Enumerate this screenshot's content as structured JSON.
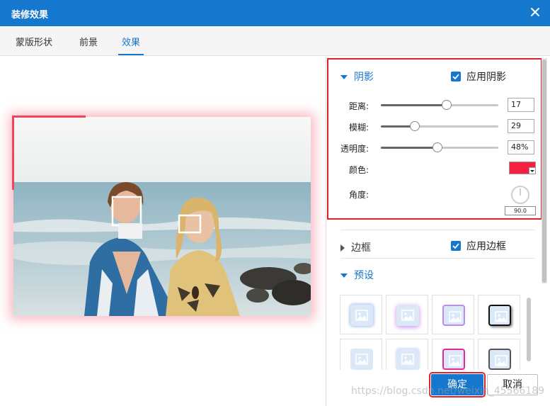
{
  "window": {
    "title": "装修效果",
    "close_icon": "close-icon"
  },
  "tabs": [
    {
      "label": "蒙版形状",
      "active": false
    },
    {
      "label": "前景",
      "active": false
    },
    {
      "label": "效果",
      "active": true
    }
  ],
  "preview": {
    "image": "beach-two-women-photo",
    "shadow_color": "#f5203f"
  },
  "shadow": {
    "section_label": "阴影",
    "apply_label": "应用阴影",
    "apply_checked": true,
    "distance": {
      "label": "距离:",
      "value": "17",
      "fraction": 0.56
    },
    "blur": {
      "label": "模糊:",
      "value": "29",
      "fraction": 0.29
    },
    "opacity": {
      "label": "透明度:",
      "value": "48%",
      "fraction": 0.48
    },
    "color": {
      "label": "颜色:",
      "value": "#f5203f"
    },
    "angle": {
      "label": "角度:",
      "value": "90.0"
    }
  },
  "border": {
    "section_label": "边框",
    "apply_label": "应用边框",
    "apply_checked": true
  },
  "presets": {
    "section_label": "预设"
  },
  "buttons": {
    "ok": "确定",
    "cancel": "取消"
  },
  "watermark": "https://blog.csdn.net/weixin_45566189",
  "colors": {
    "accent": "#1677cf",
    "highlight": "#e0202c"
  }
}
